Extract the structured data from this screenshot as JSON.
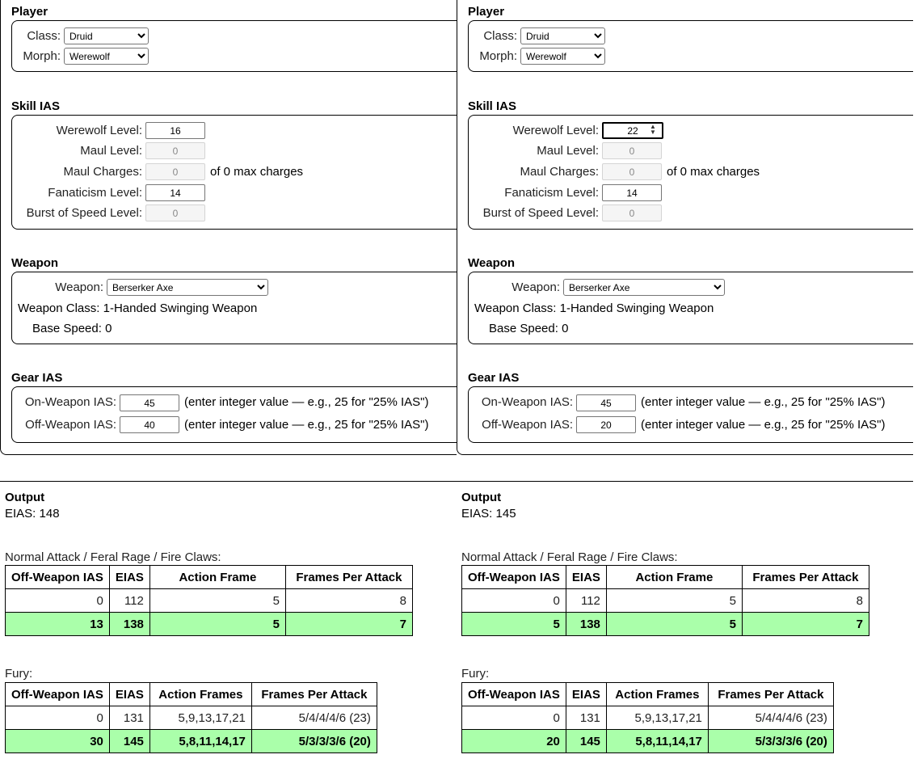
{
  "panels": [
    {
      "player": {
        "title": "Player",
        "class_label": "Class:",
        "class_value": "Druid",
        "morph_label": "Morph:",
        "morph_value": "Werewolf"
      },
      "skill": {
        "title": "Skill IAS",
        "werewolf_label": "Werewolf Level:",
        "werewolf_value": "16",
        "maul_label": "Maul Level:",
        "maul_value": "0",
        "maul_charges_label": "Maul Charges:",
        "maul_charges_value": "0",
        "maul_charges_suffix": "of 0 max charges",
        "fanaticism_label": "Fanaticism Level:",
        "fanaticism_value": "14",
        "burst_label": "Burst of Speed Level:",
        "burst_value": "0"
      },
      "weapon": {
        "title": "Weapon",
        "weapon_label": "Weapon:",
        "weapon_value": "Berserker Axe",
        "class_text": "Weapon Class: 1-Handed Swinging Weapon",
        "speed_text": "Base Speed: 0"
      },
      "gear": {
        "title": "Gear IAS",
        "on_label": "On-Weapon IAS:",
        "on_value": "45",
        "off_label": "Off-Weapon IAS:",
        "off_value": "40",
        "hint": "(enter integer value — e.g., 25 for \"25% IAS\")"
      },
      "output": {
        "title": "Output",
        "eias_text": "EIAS: 148",
        "normal_caption": "Normal Attack / Feral Rage / Fire Claws:",
        "normal_headers": [
          "Off-Weapon IAS",
          "EIAS",
          "Action Frame",
          "Frames Per Attack"
        ],
        "normal_rows": [
          [
            "0",
            "112",
            "5",
            "8"
          ],
          [
            "13",
            "138",
            "5",
            "7"
          ]
        ],
        "fury_caption": "Fury:",
        "fury_headers": [
          "Off-Weapon IAS",
          "EIAS",
          "Action Frames",
          "Frames Per Attack"
        ],
        "fury_rows": [
          [
            "0",
            "131",
            "5,9,13,17,21",
            "5/4/4/4/6 (23)"
          ],
          [
            "30",
            "145",
            "5,8,11,14,17",
            "5/3/3/3/6 (20)"
          ]
        ]
      }
    },
    {
      "player": {
        "title": "Player",
        "class_label": "Class:",
        "class_value": "Druid",
        "morph_label": "Morph:",
        "morph_value": "Werewolf"
      },
      "skill": {
        "title": "Skill IAS",
        "werewolf_label": "Werewolf Level:",
        "werewolf_value": "22",
        "maul_label": "Maul Level:",
        "maul_value": "0",
        "maul_charges_label": "Maul Charges:",
        "maul_charges_value": "0",
        "maul_charges_suffix": "of 0 max charges",
        "fanaticism_label": "Fanaticism Level:",
        "fanaticism_value": "14",
        "burst_label": "Burst of Speed Level:",
        "burst_value": "0"
      },
      "weapon": {
        "title": "Weapon",
        "weapon_label": "Weapon:",
        "weapon_value": "Berserker Axe",
        "class_text": "Weapon Class: 1-Handed Swinging Weapon",
        "speed_text": "Base Speed: 0"
      },
      "gear": {
        "title": "Gear IAS",
        "on_label": "On-Weapon IAS:",
        "on_value": "45",
        "off_label": "Off-Weapon IAS:",
        "off_value": "20",
        "hint": "(enter integer value — e.g., 25 for \"25% IAS\")"
      },
      "output": {
        "title": "Output",
        "eias_text": "EIAS: 145",
        "normal_caption": "Normal Attack / Feral Rage / Fire Claws:",
        "normal_headers": [
          "Off-Weapon IAS",
          "EIAS",
          "Action Frame",
          "Frames Per Attack"
        ],
        "normal_rows": [
          [
            "0",
            "112",
            "5",
            "8"
          ],
          [
            "5",
            "138",
            "5",
            "7"
          ]
        ],
        "fury_caption": "Fury:",
        "fury_headers": [
          "Off-Weapon IAS",
          "EIAS",
          "Action Frames",
          "Frames Per Attack"
        ],
        "fury_rows": [
          [
            "0",
            "131",
            "5,9,13,17,21",
            "5/4/4/4/6 (23)"
          ],
          [
            "20",
            "145",
            "5,8,11,14,17",
            "5/3/3/3/6 (20)"
          ]
        ]
      }
    }
  ],
  "colors": {
    "highlight_row": "#aaffaa"
  }
}
